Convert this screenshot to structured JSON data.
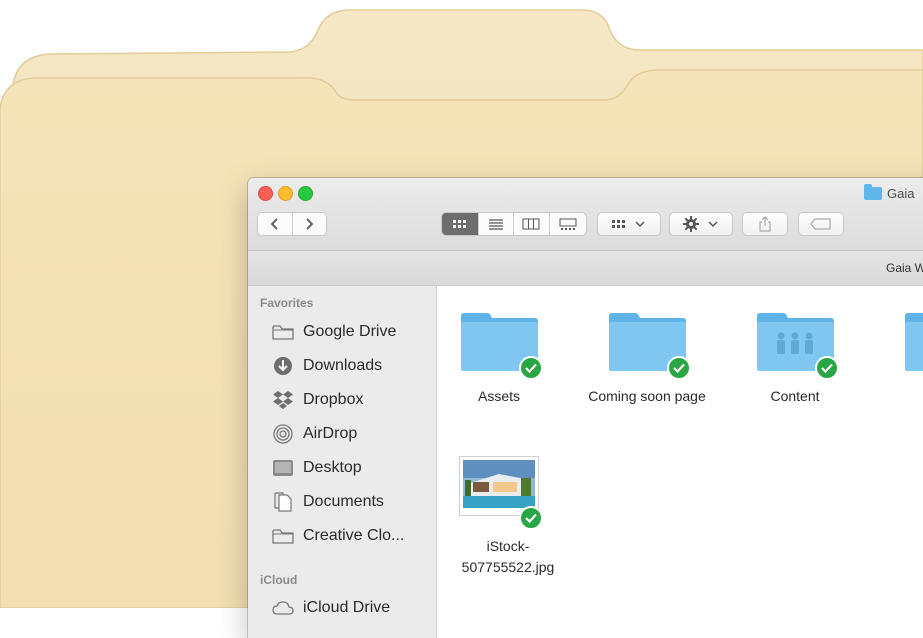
{
  "window": {
    "title": "Gaia",
    "path": "Gaia W"
  },
  "toolbar": {
    "back_icon": "chevron-left-icon",
    "forward_icon": "chevron-right-icon",
    "view_modes": [
      "icon-view",
      "list-view",
      "column-view",
      "gallery-view"
    ],
    "active_view": "icon-view"
  },
  "sidebar": {
    "favorites_label": "Favorites",
    "items": [
      {
        "label": "Google Drive",
        "icon": "folder-icon"
      },
      {
        "label": "Downloads",
        "icon": "download-icon"
      },
      {
        "label": "Dropbox",
        "icon": "dropbox-icon"
      },
      {
        "label": "AirDrop",
        "icon": "airdrop-icon"
      },
      {
        "label": "Desktop",
        "icon": "desktop-icon"
      },
      {
        "label": "Documents",
        "icon": "document-icon"
      },
      {
        "label": "Creative Clo...",
        "icon": "folder-icon"
      }
    ],
    "icloud_label": "iCloud",
    "icloud_items": [
      {
        "label": "iCloud Drive",
        "icon": "cloud-icon"
      }
    ]
  },
  "files": [
    {
      "name": "Assets",
      "type": "folder"
    },
    {
      "name": "Coming soon page",
      "type": "folder"
    },
    {
      "name": "Content",
      "type": "shared-folder"
    },
    {
      "name": "",
      "type": "folder"
    },
    {
      "name": "iStock-507755522.jpg",
      "type": "image"
    }
  ],
  "colors": {
    "manila": "#f3e1b6",
    "folder_blue": "#62b8ec",
    "synced_green": "#2aa745"
  }
}
